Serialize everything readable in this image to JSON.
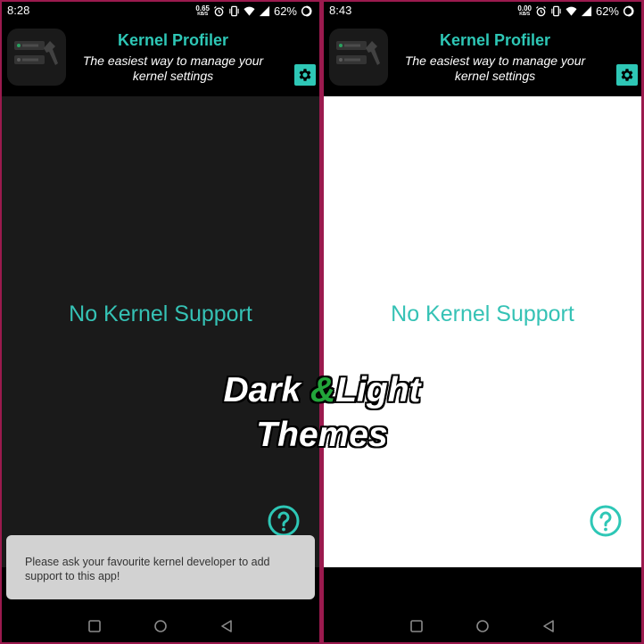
{
  "overlay": {
    "word1": "Dark ",
    "ampersand": "&",
    "word2": "Light",
    "line2": "Themes",
    "ampersand_color": "#22a63a"
  },
  "accent_color": "#2ec7b6",
  "screens": [
    {
      "theme": "dark",
      "status": {
        "time": "8:28",
        "net_speed": "0.65",
        "net_unit": "KB/S",
        "battery": "62%"
      },
      "header": {
        "title": "Kernel Profiler",
        "subtitle_line1": "The easiest way to manage your",
        "subtitle_line2": "kernel settings"
      },
      "message": "No Kernel Support",
      "snackbar": "Please ask your favourite kernel developer to add support to this app!"
    },
    {
      "theme": "light",
      "status": {
        "time": "8:43",
        "net_speed": "0.00",
        "net_unit": "KB/S",
        "battery": "62%"
      },
      "header": {
        "title": "Kernel Profiler",
        "subtitle_line1": "The easiest way to manage your",
        "subtitle_line2": "kernel settings"
      },
      "message": "No Kernel Support"
    }
  ],
  "icons": {
    "logo": "app-logo-icon",
    "settings": "gear-icon",
    "help": "help-circle-icon",
    "nav": [
      "recent-apps-icon",
      "home-icon",
      "back-icon"
    ],
    "status": [
      "alarm-icon",
      "vibrate-icon",
      "wifi-icon",
      "signal-icon",
      "battery-icon"
    ]
  }
}
